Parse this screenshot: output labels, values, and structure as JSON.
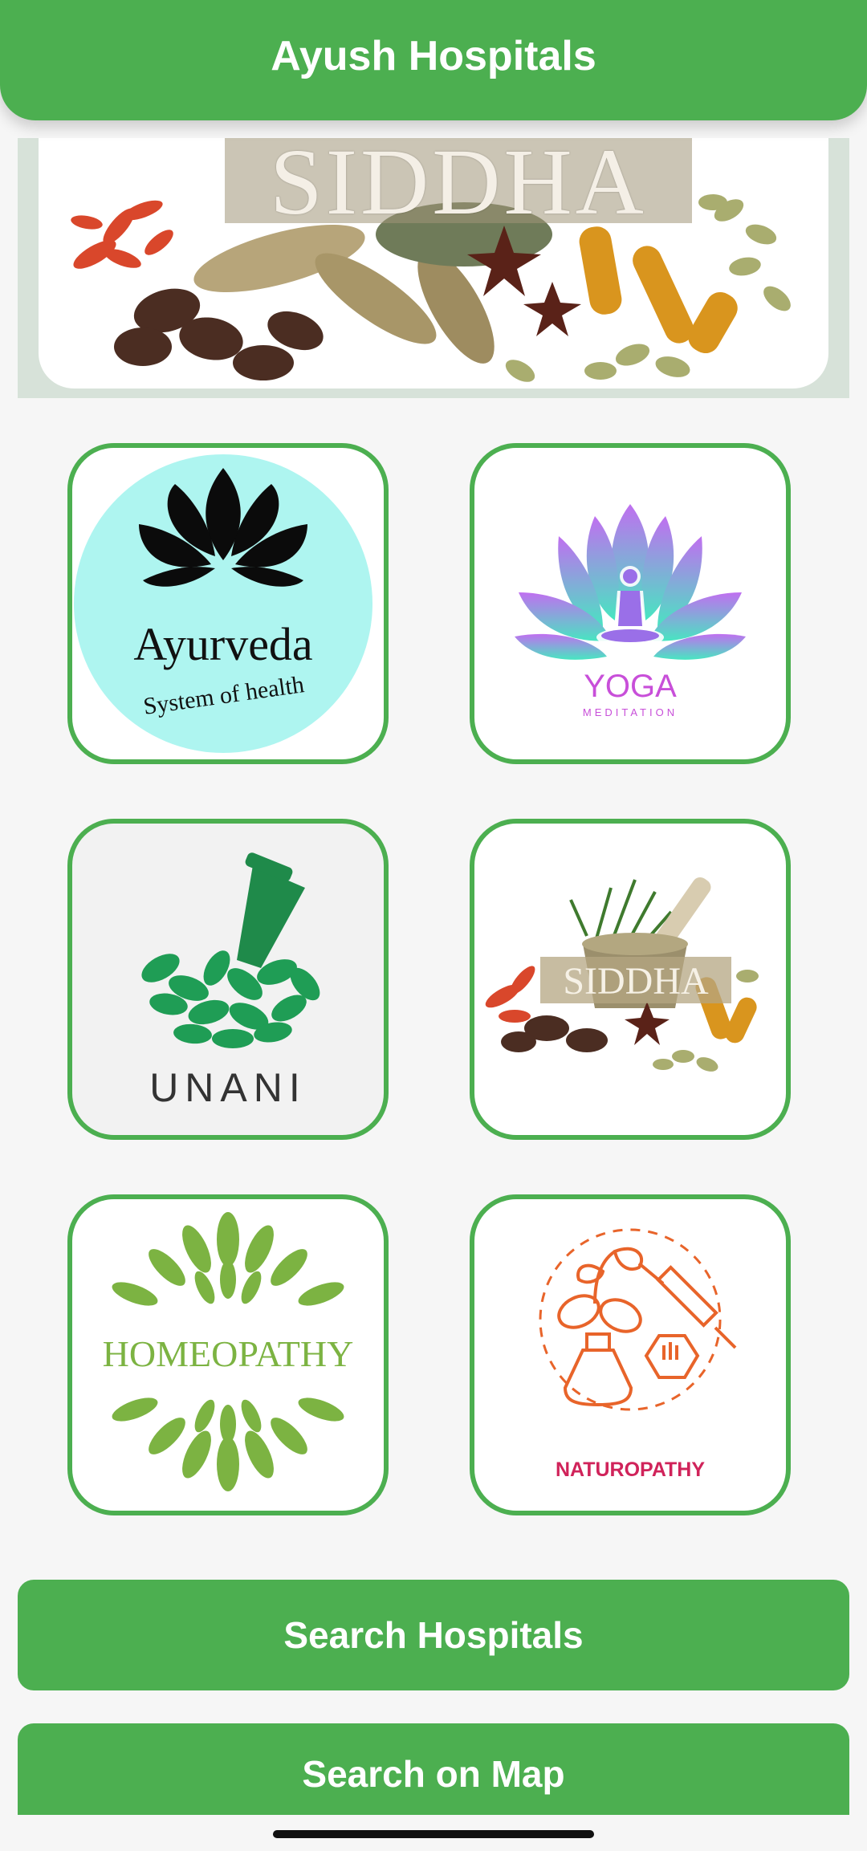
{
  "app_bar": {
    "title": "Ayush Hospitals"
  },
  "banner": {
    "title": "SIDDHA"
  },
  "tiles": {
    "ayurveda": {
      "title": "Ayurveda",
      "subtitle": "System of health"
    },
    "yoga": {
      "title": "YOGA",
      "subtitle": "MEDITATION"
    },
    "unani": {
      "title": "UNANI"
    },
    "siddha": {
      "title": "SIDDHA"
    },
    "homeopathy": {
      "title": "HOMEOPATHY"
    },
    "naturopathy": {
      "title": "NATUROPATHY"
    }
  },
  "buttons": {
    "search_hospitals": "Search Hospitals",
    "search_on_map": "Search on Map"
  },
  "colors": {
    "primary": "#4caf50",
    "background": "#f6f6f6",
    "ayurveda_circle": "#aef5f0",
    "yoga_pink": "#c84fd9",
    "homeopathy_green": "#7cb342",
    "naturopathy_red": "#d0235a"
  }
}
